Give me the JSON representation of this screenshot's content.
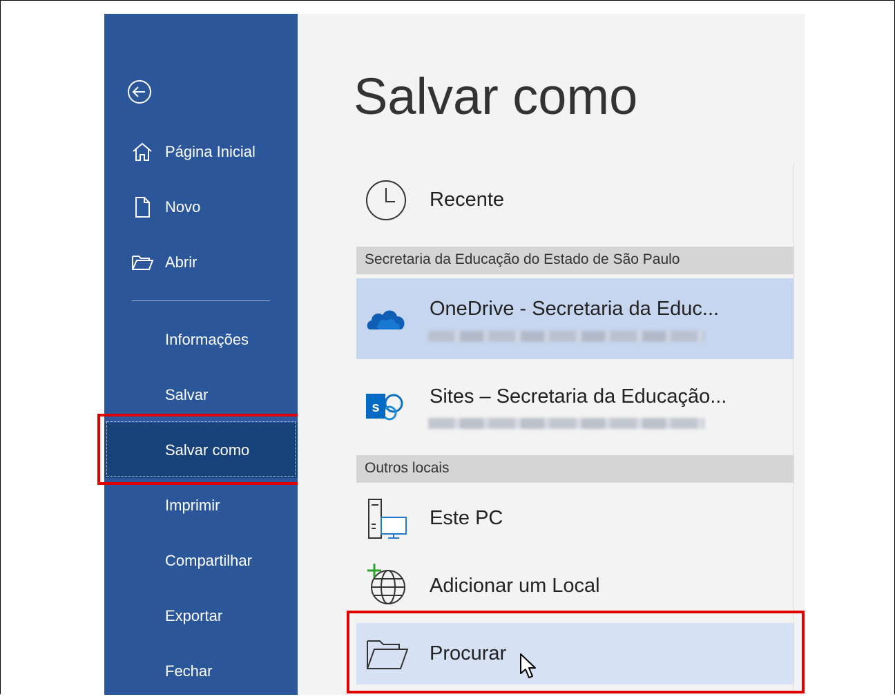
{
  "sidebar": {
    "back_icon": "back-arrow-icon",
    "items": [
      {
        "label": "Página Inicial",
        "icon": "home-icon"
      },
      {
        "label": "Novo",
        "icon": "new-document-icon"
      },
      {
        "label": "Abrir",
        "icon": "open-folder-icon"
      },
      {
        "label": "Informações"
      },
      {
        "label": "Salvar"
      },
      {
        "label": "Salvar como",
        "active": true
      },
      {
        "label": "Imprimir"
      },
      {
        "label": "Compartilhar"
      },
      {
        "label": "Exportar"
      },
      {
        "label": "Fechar"
      }
    ]
  },
  "main": {
    "title": "Salvar como",
    "recent_label": "Recente",
    "section_org": "Secretaria da Educação do Estado de São Paulo",
    "onedrive_label": "OneDrive - Secretaria da Educ...",
    "sites_label": "Sites – Secretaria da Educação...",
    "section_other": "Outros locais",
    "thispc_label": "Este PC",
    "addplace_label": "Adicionar um Local",
    "browse_label": "Procurar"
  },
  "colors": {
    "sidebar_bg": "#2b579a",
    "sidebar_active": "#18427a",
    "content_bg": "#f3f3f3",
    "selected_row": "#c6d6ef",
    "highlight_box": "#e00000"
  }
}
